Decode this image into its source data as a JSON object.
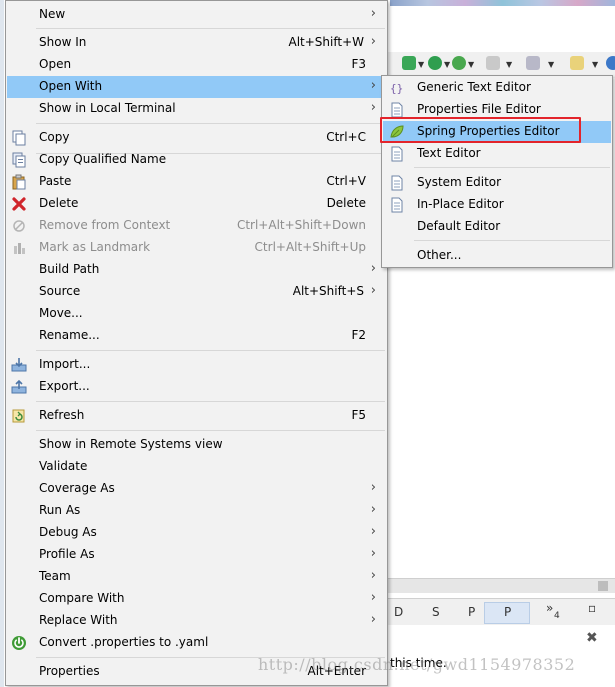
{
  "menu": {
    "items": [
      {
        "label": "New",
        "accel": "",
        "arrow": true,
        "icon": "",
        "disabled": false,
        "highlighted": false
      },
      {
        "label": "Show In",
        "accel": "Alt+Shift+W",
        "arrow": true,
        "icon": "",
        "disabled": false,
        "highlighted": false
      },
      {
        "label": "Open",
        "accel": "F3",
        "arrow": false,
        "icon": "",
        "disabled": false,
        "highlighted": false
      },
      {
        "label": "Open With",
        "accel": "",
        "arrow": true,
        "icon": "",
        "disabled": false,
        "highlighted": true
      },
      {
        "label": "Show in Local Terminal",
        "accel": "",
        "arrow": true,
        "icon": "",
        "disabled": false,
        "highlighted": false
      },
      {
        "label": "Copy",
        "accel": "Ctrl+C",
        "arrow": false,
        "icon": "copy-icon",
        "disabled": false,
        "highlighted": false
      },
      {
        "label": "Copy Qualified Name",
        "accel": "",
        "arrow": false,
        "icon": "copy-qualified-icon",
        "disabled": false,
        "highlighted": false
      },
      {
        "label": "Paste",
        "accel": "Ctrl+V",
        "arrow": false,
        "icon": "paste-icon",
        "disabled": false,
        "highlighted": false
      },
      {
        "label": "Delete",
        "accel": "Delete",
        "arrow": false,
        "icon": "delete-icon",
        "disabled": false,
        "highlighted": false
      },
      {
        "label": "Remove from Context",
        "accel": "Ctrl+Alt+Shift+Down",
        "arrow": false,
        "icon": "remove-context-icon",
        "disabled": true,
        "highlighted": false
      },
      {
        "label": "Mark as Landmark",
        "accel": "Ctrl+Alt+Shift+Up",
        "arrow": false,
        "icon": "landmark-icon",
        "disabled": true,
        "highlighted": false
      },
      {
        "label": "Build Path",
        "accel": "",
        "arrow": true,
        "icon": "",
        "disabled": false,
        "highlighted": false
      },
      {
        "label": "Source",
        "accel": "Alt+Shift+S",
        "arrow": true,
        "icon": "",
        "disabled": false,
        "highlighted": false
      },
      {
        "label": "Move...",
        "accel": "",
        "arrow": false,
        "icon": "",
        "disabled": false,
        "highlighted": false
      },
      {
        "label": "Rename...",
        "accel": "F2",
        "arrow": false,
        "icon": "",
        "disabled": false,
        "highlighted": false
      },
      {
        "label": "Import...",
        "accel": "",
        "arrow": false,
        "icon": "import-icon",
        "disabled": false,
        "highlighted": false
      },
      {
        "label": "Export...",
        "accel": "",
        "arrow": false,
        "icon": "export-icon",
        "disabled": false,
        "highlighted": false
      },
      {
        "label": "Refresh",
        "accel": "F5",
        "arrow": false,
        "icon": "refresh-icon",
        "disabled": false,
        "highlighted": false
      },
      {
        "label": "Show in Remote Systems view",
        "accel": "",
        "arrow": false,
        "icon": "",
        "disabled": false,
        "highlighted": false
      },
      {
        "label": "Validate",
        "accel": "",
        "arrow": false,
        "icon": "",
        "disabled": false,
        "highlighted": false
      },
      {
        "label": "Coverage As",
        "accel": "",
        "arrow": true,
        "icon": "",
        "disabled": false,
        "highlighted": false
      },
      {
        "label": "Run As",
        "accel": "",
        "arrow": true,
        "icon": "",
        "disabled": false,
        "highlighted": false
      },
      {
        "label": "Debug As",
        "accel": "",
        "arrow": true,
        "icon": "",
        "disabled": false,
        "highlighted": false
      },
      {
        "label": "Profile As",
        "accel": "",
        "arrow": true,
        "icon": "",
        "disabled": false,
        "highlighted": false
      },
      {
        "label": "Team",
        "accel": "",
        "arrow": true,
        "icon": "",
        "disabled": false,
        "highlighted": false
      },
      {
        "label": "Compare With",
        "accel": "",
        "arrow": true,
        "icon": "",
        "disabled": false,
        "highlighted": false
      },
      {
        "label": "Replace With",
        "accel": "",
        "arrow": true,
        "icon": "",
        "disabled": false,
        "highlighted": false
      },
      {
        "label": "Convert .properties to .yaml",
        "accel": "",
        "arrow": false,
        "icon": "spring-power-icon",
        "disabled": false,
        "highlighted": false
      },
      {
        "label": "Properties",
        "accel": "Alt+Enter",
        "arrow": false,
        "icon": "",
        "disabled": false,
        "highlighted": false
      }
    ],
    "arrow_glyph": "›"
  },
  "submenu": {
    "items": [
      {
        "label": "Generic Text Editor",
        "icon": "generic-text-editor-icon",
        "highlighted": false
      },
      {
        "label": "Properties File Editor",
        "icon": "document-icon",
        "highlighted": false
      },
      {
        "label": "Spring Properties Editor",
        "icon": "spring-leaf-icon",
        "highlighted": true
      },
      {
        "label": "Text Editor",
        "icon": "document-icon",
        "highlighted": false
      },
      {
        "label": "System Editor",
        "icon": "document-icon",
        "highlighted": false
      },
      {
        "label": "In-Place Editor",
        "icon": "document-icon",
        "highlighted": false
      },
      {
        "label": "Default Editor",
        "icon": "",
        "highlighted": false
      },
      {
        "label": "Other...",
        "icon": "",
        "highlighted": false
      }
    ]
  },
  "background": {
    "status_text": "this time.",
    "tabs": [
      "D",
      "S",
      "P",
      "P",
      "»",
      "4"
    ],
    "watermark": "http://blog.csdn.net/gwd1154978352"
  },
  "colors": {
    "highlight": "#91c9f7",
    "menu_bg": "#f2f2f2",
    "annotation_red": "#e3242b",
    "disabled_text": "#8d8d8d"
  }
}
